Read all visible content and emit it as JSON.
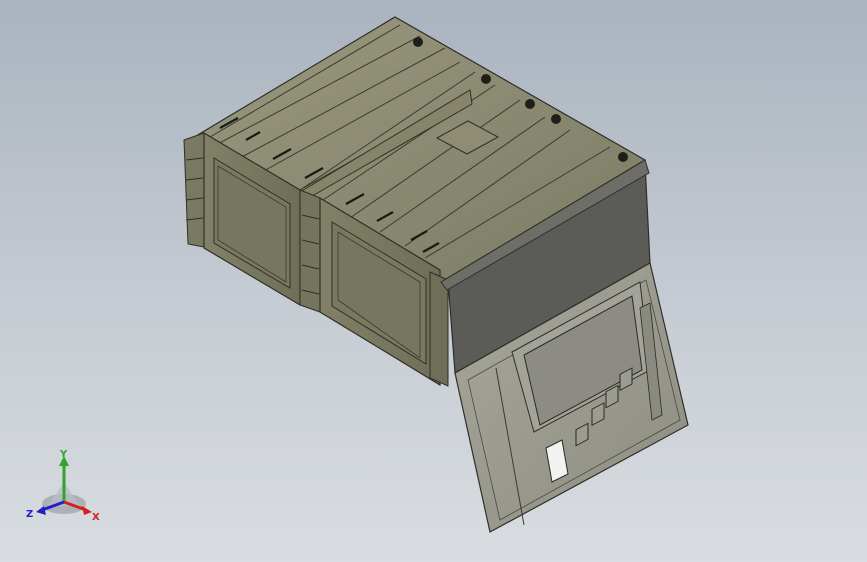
{
  "viewport": {
    "background_top": "#aab3bf",
    "background_bottom": "#d9dde1"
  },
  "model": {
    "description_icon": "3d-enclosure-model",
    "body_color": "#8e8d73",
    "edge_color": "#2f2f29",
    "front_panel_color": "#5b5b57",
    "door_color": "#9a9a8e",
    "screen_color": "#8c8c84"
  },
  "triad": {
    "y_label": "Y",
    "x_label": "X",
    "z_label": "Z",
    "y_color": "#2ea52e",
    "x_color": "#d42020",
    "z_color": "#2020c8"
  }
}
